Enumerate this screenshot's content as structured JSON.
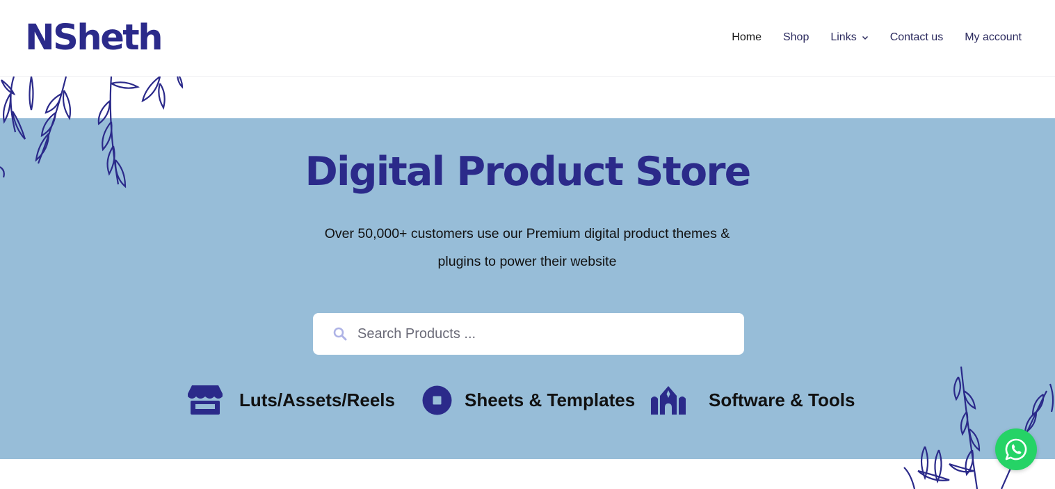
{
  "colors": {
    "brand": "#2b2a8a",
    "hero_bg": "#97bdd8",
    "whatsapp": "#25d366",
    "nav_text": "#2b2a5e",
    "nav_active": "#1a1a1a",
    "search_icon": "#aeb3e6"
  },
  "header": {
    "logo": "NSheth",
    "nav": [
      {
        "label": "Home",
        "active": true
      },
      {
        "label": "Shop"
      },
      {
        "label": "Links",
        "has_dropdown": true
      },
      {
        "label": "Contact us"
      },
      {
        "label": "My account"
      }
    ]
  },
  "hero": {
    "title": "Digital Product Store",
    "subtitle": "Over 50,000+ customers use our Premium digital product themes & plugins to power their website",
    "search": {
      "placeholder": "Search Products ...",
      "icon": "search-icon"
    },
    "categories": [
      {
        "label": "Luts/Assets/Reels",
        "icon": "store-icon"
      },
      {
        "label": "Sheets & Templates",
        "icon": "stop-circle-icon"
      },
      {
        "label": "Software & Tools",
        "icon": "synagogue-icon"
      }
    ]
  },
  "floating": {
    "whatsapp_icon": "whatsapp-icon"
  }
}
